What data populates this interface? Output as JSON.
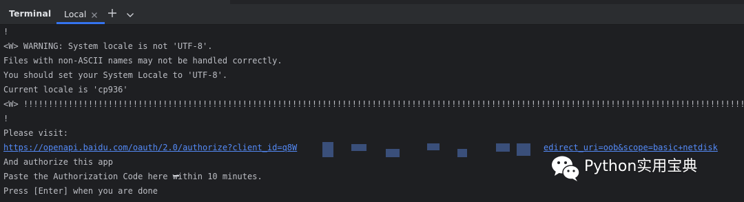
{
  "header": {
    "tool_title": "Terminal",
    "tabs": [
      {
        "label": "Local",
        "active": true
      }
    ],
    "icons": {
      "close": "close-icon",
      "new_tab": "plus-icon",
      "tab_menu": "chevron-down-icon"
    }
  },
  "terminal": {
    "lines": [
      "!",
      "<W> WARNING: System locale is not 'UTF-8'.",
      "Files with non-ASCII names may not be handled correctly.",
      "You should set your System Locale to 'UTF-8'.",
      "Current locale is 'cp936'",
      "<W> !!!!!!!!!!!!!!!!!!!!!!!!!!!!!!!!!!!!!!!!!!!!!!!!!!!!!!!!!!!!!!!!!!!!!!!!!!!!!!!!!!!!!!!!!!!!!!!!!!!!!!!!!!!!!!!!!!!!!!!!!!!!!!!!!!!!!!!!!!!!!!!!!!!!!!!!!!!!",
      "!",
      "Please visit:"
    ],
    "link_prefix": "https://openapi.baidu.com/oauth/2.0/authorize?client_id=q8W",
    "link_suffix": "edirect_uri=oob&scope=basic+netdisk",
    "lines_after": [
      "And authorize this app",
      "Paste the Authorization Code here within 10 minutes.",
      "Press [Enter] when you are done"
    ]
  },
  "watermark": {
    "text": "Python实用宝典",
    "logo": "wechat-logo"
  },
  "colors": {
    "background": "#1e1f22",
    "tabbar": "#2b2d30",
    "text": "#bcbec4",
    "link": "#548af7",
    "accent": "#3574f0"
  }
}
